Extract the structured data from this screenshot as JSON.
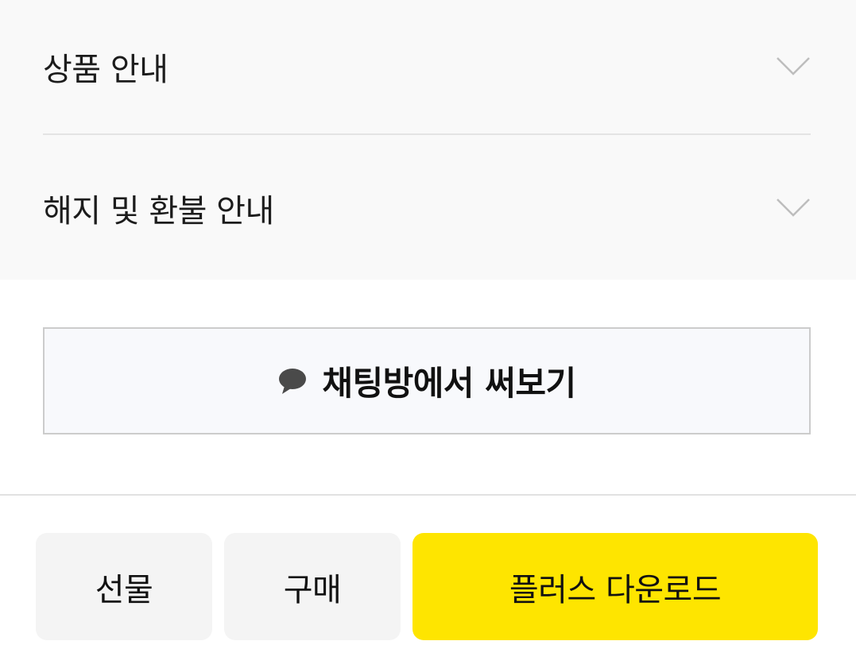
{
  "accordion": {
    "items": [
      {
        "label": "상품 안내",
        "icon": "chevron-down-icon"
      },
      {
        "label": "해지 및 환불 안내",
        "icon": "chevron-down-icon"
      }
    ]
  },
  "chat_button": {
    "label": "채팅방에서 써보기",
    "icon": "speech-bubble-icon"
  },
  "bottom_bar": {
    "gift_label": "선물",
    "buy_label": "구매",
    "download_label": "플러스 다운로드"
  },
  "colors": {
    "accent": "#fee500",
    "panel_bg": "#f9f9f9",
    "button_bg": "#f4f4f4"
  }
}
